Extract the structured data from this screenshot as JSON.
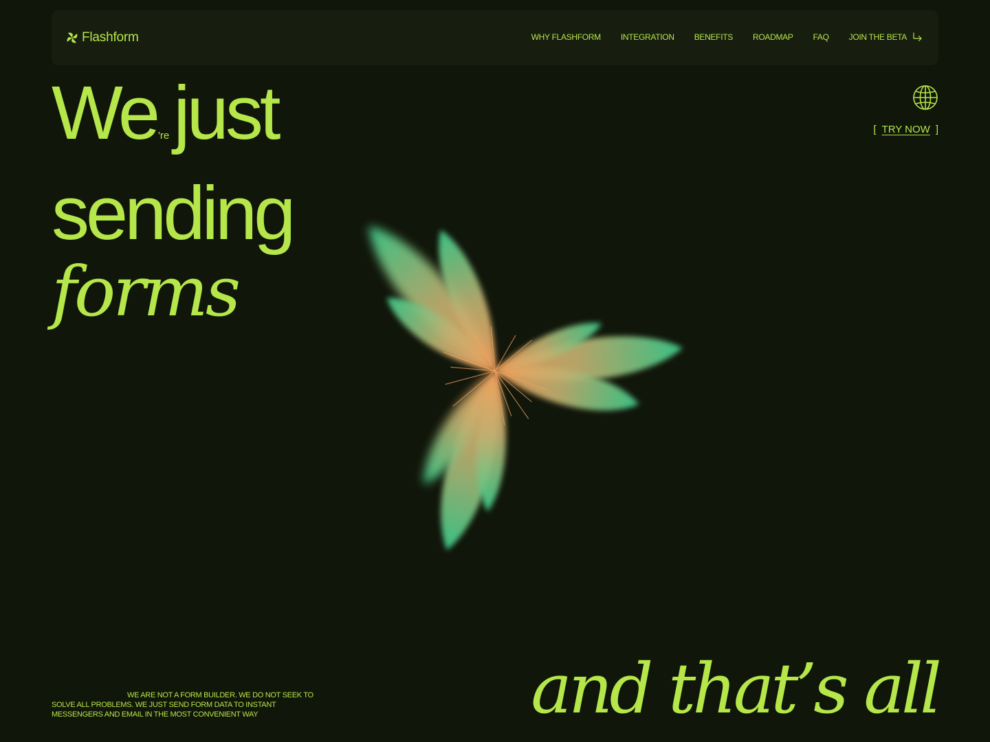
{
  "brand": {
    "name": "Flashform",
    "logo_icon": "pinwheel-logo-icon"
  },
  "nav": {
    "items": [
      {
        "label": "WHY FLASHFORM"
      },
      {
        "label": "INTEGRATION"
      },
      {
        "label": "BENEFITS"
      },
      {
        "label": "ROADMAP"
      },
      {
        "label": "FAQ"
      }
    ],
    "cta": {
      "label": "JOIN THE BETA",
      "icon": "arrow-down-right-icon"
    }
  },
  "hero": {
    "line1_word1": "We",
    "line1_sup": "'re",
    "line1_word2": "just",
    "line2": "sending",
    "line3": "forms"
  },
  "side": {
    "globe_icon": "globe-icon",
    "bracket_open": "[",
    "try_now": "TRY NOW",
    "bracket_close": "]"
  },
  "footer": {
    "tagline": "WE ARE NOT A FORM BUILDER. WE DO NOT SEEK TO SOLVE ALL PROBLEMS. WE JUST SEND FORM DATA TO INSTANT MESSENGERS AND EMAIL IN THE MOST CONVENIENT WAY",
    "closing": "and that’s all"
  },
  "colors": {
    "background": "#11160a",
    "navbar": "#171d0f",
    "accent": "#b5e64a",
    "petal_center": "#f4a25e",
    "petal_tip": "#3fcf8e"
  }
}
